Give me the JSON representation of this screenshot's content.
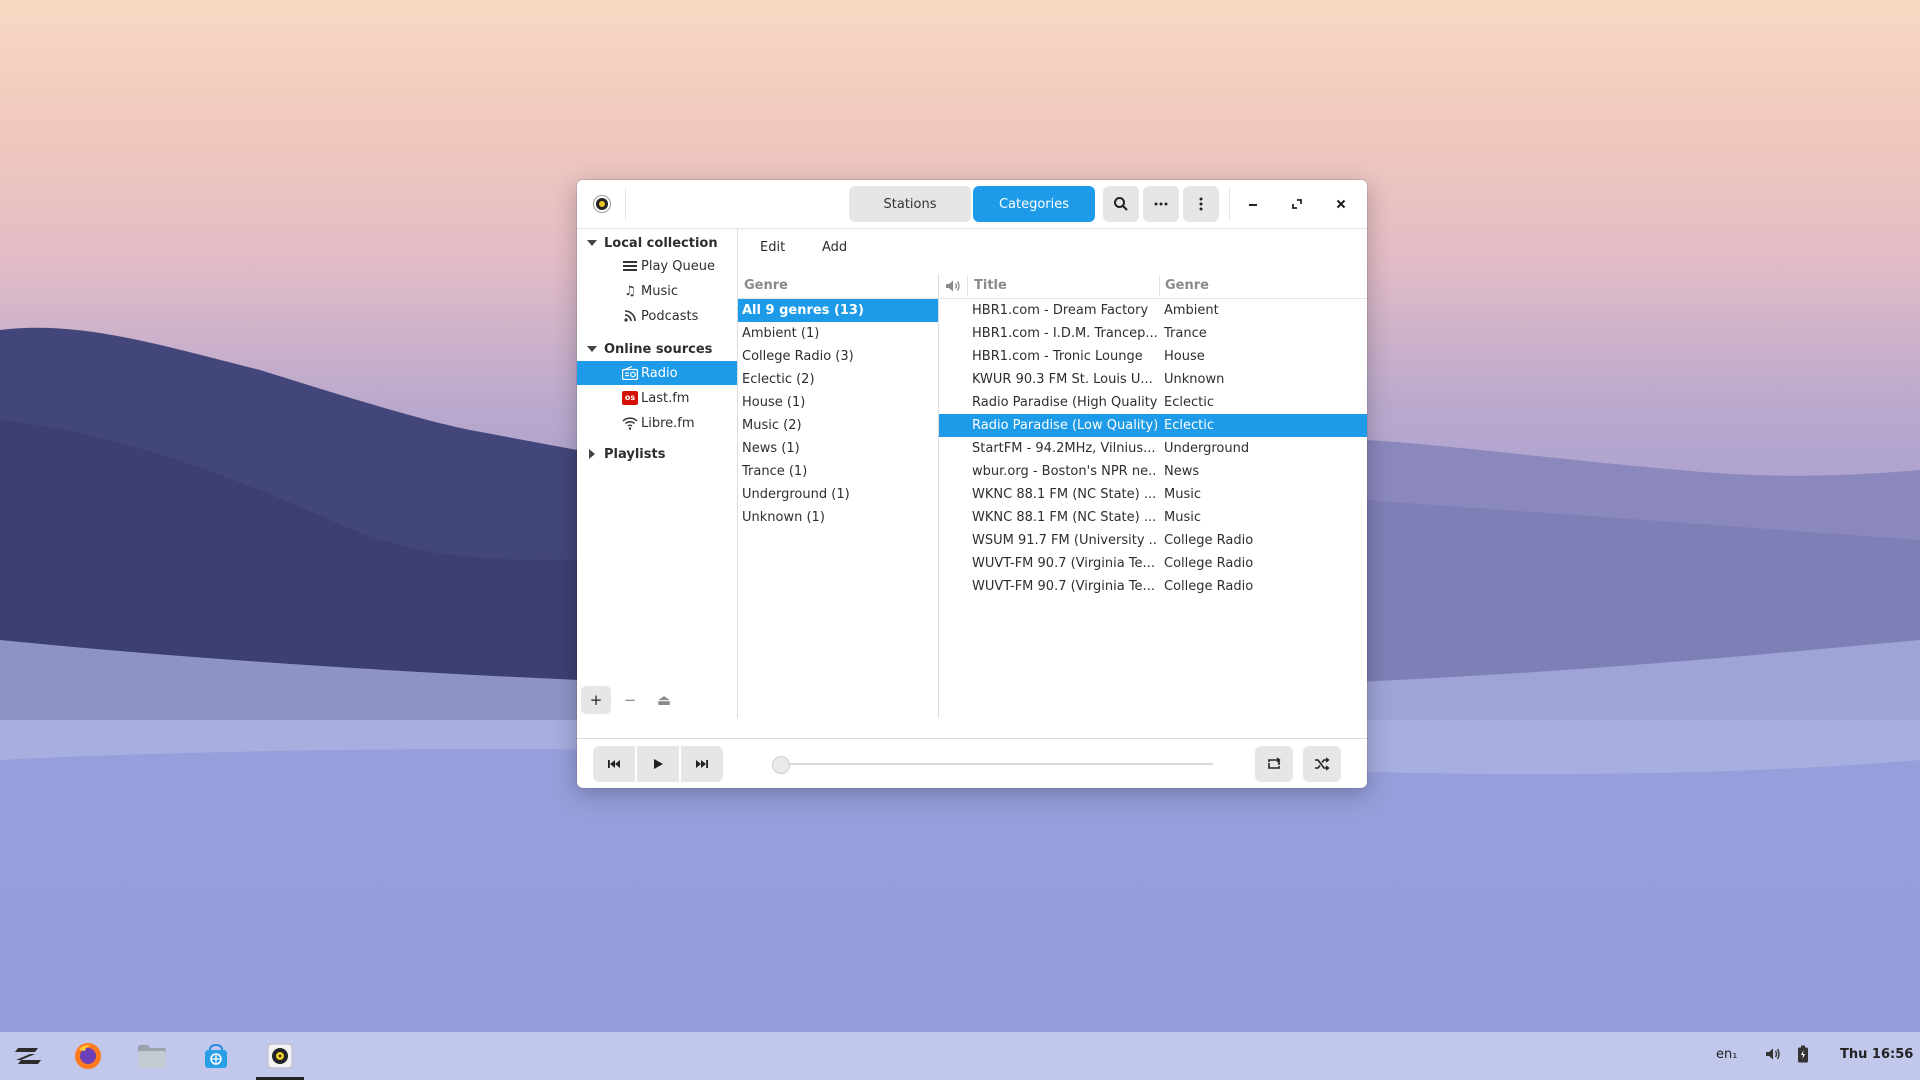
{
  "window": {
    "tabs": [
      "Stations",
      "Categories"
    ],
    "active_tab": "Categories",
    "header_icons": [
      "search-icon",
      "ellipsis-icon",
      "menu-icon"
    ],
    "window_controls": [
      "minimize-icon",
      "maximize-icon",
      "close-icon"
    ]
  },
  "sidebar": {
    "local_collection": "Local collection",
    "items_local": [
      {
        "label": "Play Queue",
        "icon": "list-icon"
      },
      {
        "label": "Music",
        "icon": "music-note-icon"
      },
      {
        "label": "Podcasts",
        "icon": "rss-icon"
      }
    ],
    "online_sources": "Online sources",
    "items_online": [
      {
        "label": "Radio",
        "icon": "radio-icon"
      },
      {
        "label": "Last.fm",
        "icon": "lastfm-icon"
      },
      {
        "label": "Libre.fm",
        "icon": "wifi-icon"
      }
    ],
    "selected": "Radio",
    "playlists": "Playlists",
    "footer_buttons": [
      "+",
      "−",
      "⏏"
    ]
  },
  "toolbar": {
    "edit": "Edit",
    "add": "Add"
  },
  "genres": {
    "header": "Genre",
    "items": [
      "All 9 genres (13)",
      "Ambient (1)",
      "College Radio (3)",
      "Eclectic (2)",
      "House (1)",
      "Music (2)",
      "News (1)",
      "Trance (1)",
      "Underground (1)",
      "Unknown (1)"
    ],
    "selected": "All 9 genres (13)"
  },
  "stations": {
    "col_title": "Title",
    "col_genre": "Genre",
    "rows": [
      {
        "title": "HBR1.com - Dream Factory",
        "genre": "Ambient"
      },
      {
        "title": "HBR1.com - I.D.M. Trancep...",
        "genre": "Trance"
      },
      {
        "title": "HBR1.com - Tronic Lounge",
        "genre": "House"
      },
      {
        "title": "KWUR 90.3 FM St. Louis U...",
        "genre": "Unknown"
      },
      {
        "title": "Radio Paradise (High Quality)",
        "genre": "Eclectic"
      },
      {
        "title": "Radio Paradise (Low Quality)",
        "genre": "Eclectic"
      },
      {
        "title": "StartFM - 94.2MHz, Vilnius...",
        "genre": "Underground"
      },
      {
        "title": "wbur.org - Boston's NPR ne...",
        "genre": "News"
      },
      {
        "title": "WKNC 88.1 FM (NC State) ...",
        "genre": "Music"
      },
      {
        "title": "WKNC 88.1 FM (NC State) ...",
        "genre": "Music"
      },
      {
        "title": "WSUM 91.7 FM (University ...",
        "genre": "College Radio"
      },
      {
        "title": "WUVT-FM 90.7 (Virginia Te...",
        "genre": "College Radio"
      },
      {
        "title": "WUVT-FM 90.7 (Virginia Te...",
        "genre": "College Radio"
      }
    ],
    "selected_index": 5
  },
  "player": {
    "progress": 0,
    "buttons": [
      "previous-icon",
      "play-icon",
      "next-icon",
      "repeat-icon",
      "shuffle-icon"
    ]
  },
  "taskbar": {
    "apps": [
      "zorin-menu-icon",
      "firefox-icon",
      "files-icon",
      "software-store-icon",
      "rhythmbox-icon"
    ],
    "keyboard_layout": "en₁",
    "clock": "Thu 16:56"
  },
  "colors": {
    "accent": "#1e9be8"
  }
}
